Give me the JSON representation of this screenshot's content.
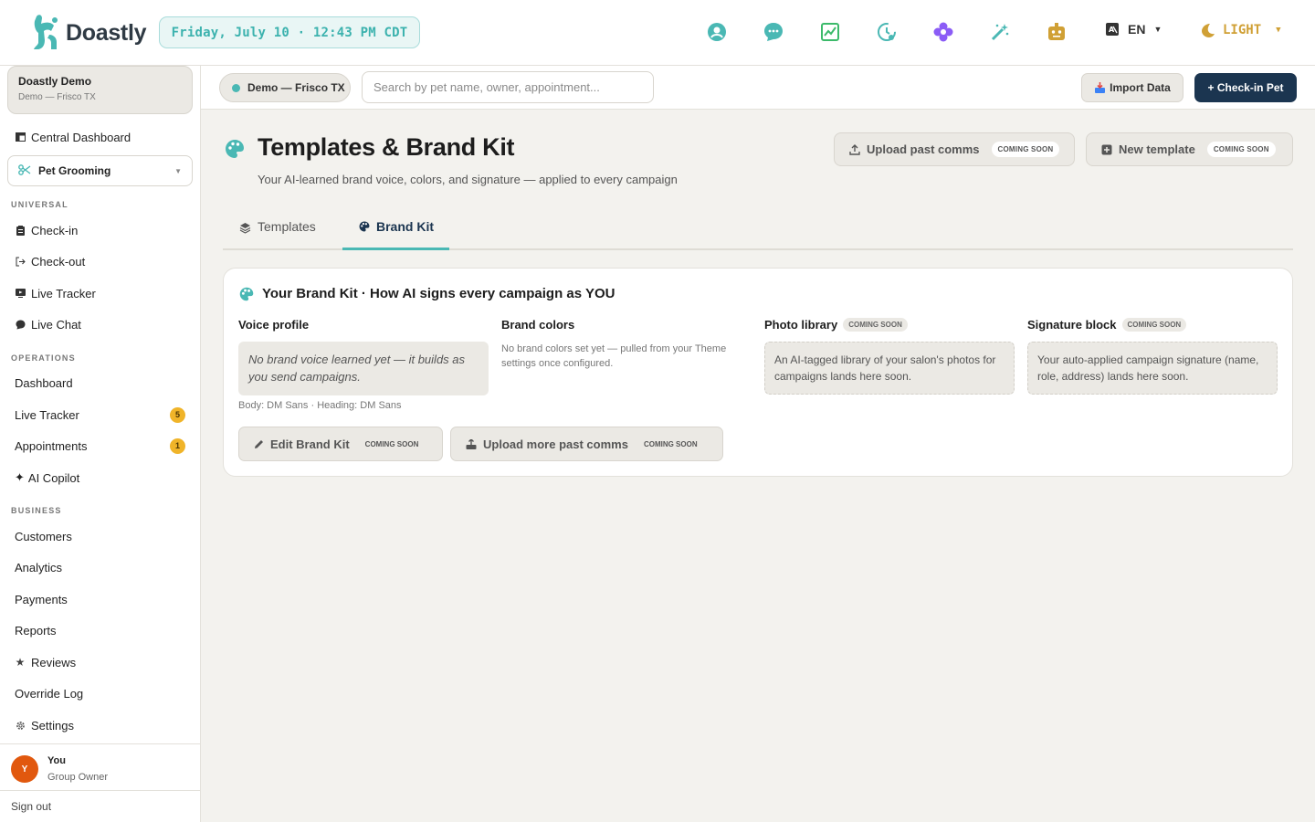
{
  "app": {
    "name": "Doastly",
    "datetime": "Friday, July 10 · 12:43 PM CDT",
    "language": "EN",
    "theme": "LIGHT"
  },
  "top_icons": [
    "support-icon",
    "chat-bubble-icon",
    "chart-icon",
    "clock-icon",
    "flower-icon",
    "magic-wand-icon",
    "robot-icon"
  ],
  "sidebar": {
    "org_name": "Doastly Demo",
    "org_location": "Demo — Frisco TX",
    "central_dashboard": "Central Dashboard",
    "module_select": "Pet Grooming",
    "sections": {
      "universal": "UNIVERSAL",
      "operations": "OPERATIONS",
      "business": "BUSINESS"
    },
    "universal_items": [
      "Check-in",
      "Check-out",
      "Live Tracker",
      "Live Chat"
    ],
    "operations_items": [
      {
        "label": "Dashboard",
        "badge": ""
      },
      {
        "label": "Live Tracker",
        "badge": "5"
      },
      {
        "label": "Appointments",
        "badge": "1"
      },
      {
        "label": "AI Copilot",
        "badge": ""
      }
    ],
    "business_items": [
      "Customers",
      "Analytics",
      "Payments",
      "Reports",
      "Reviews",
      "Override Log",
      "Settings"
    ],
    "user": {
      "initial": "Y",
      "name": "You",
      "role": "Group Owner"
    },
    "sign_out": "Sign out"
  },
  "subbar": {
    "location": "Demo — Frisco TX",
    "search_placeholder": "Search by pet name, owner, appointment...",
    "import_label": "Import Data",
    "checkin_label": "+ Check-in Pet"
  },
  "page": {
    "title": "Templates & Brand Kit",
    "subtitle": "Your AI-learned brand voice, colors, and signature — applied to every campaign",
    "upload_btn": "Upload past comms",
    "new_template_btn": "New template",
    "coming_soon": "COMING SOON"
  },
  "tabs": [
    "Templates",
    "Brand Kit"
  ],
  "active_tab": "Brand Kit",
  "brand_kit": {
    "title": "Your Brand Kit · How AI signs every campaign as YOU",
    "voice_label": "Voice profile",
    "voice_text": "No brand voice learned yet — it builds as you send campaigns.",
    "fonts": "Body: DM Sans · Heading: DM Sans",
    "colors_label": "Brand colors",
    "colors_text": "No brand colors set yet — pulled from your Theme settings once configured.",
    "photo_label": "Photo library",
    "photo_text": "An AI-tagged library of your salon's photos for campaigns lands here soon.",
    "signature_label": "Signature block",
    "signature_text": "Your auto-applied campaign signature (name, role, address) lands here soon.",
    "edit_btn": "Edit Brand Kit",
    "upload_more_btn": "Upload more past comms"
  },
  "colors": {
    "accent_teal": "#4ab8b4",
    "navy": "#1b3550",
    "badge_yellow": "#f0b429",
    "avatar_orange": "#e1580e",
    "theme_gold": "#d0a035"
  }
}
